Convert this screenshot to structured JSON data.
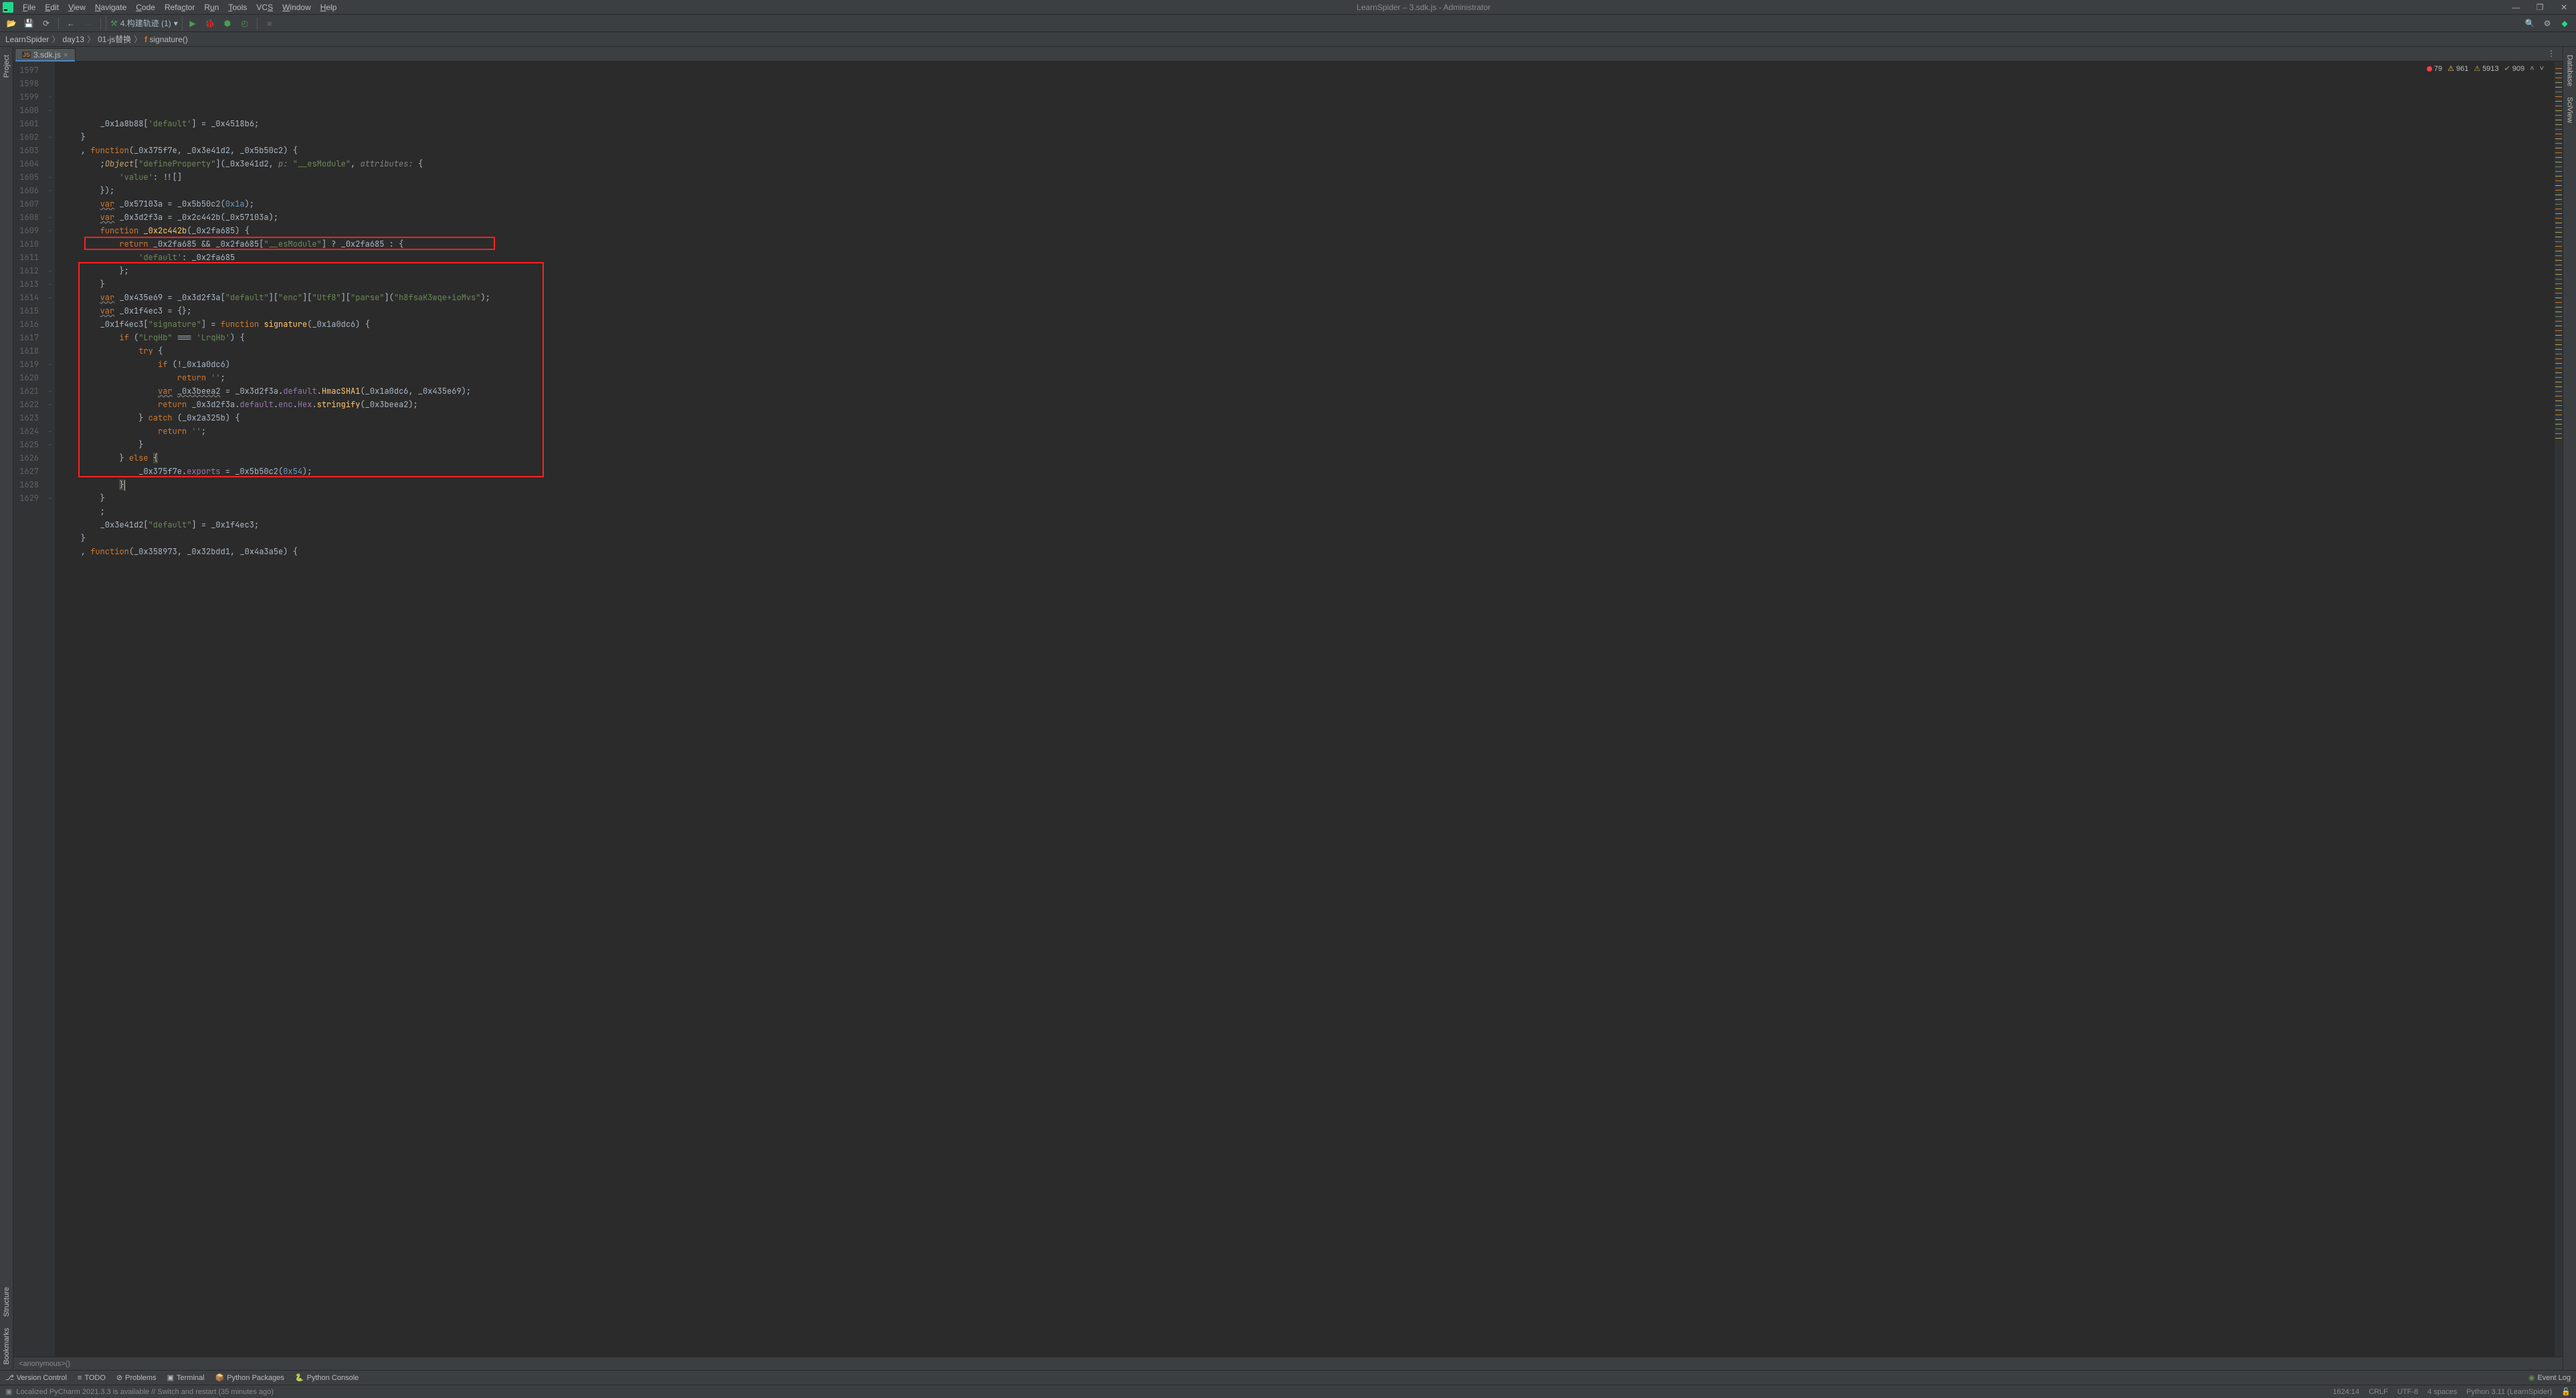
{
  "window": {
    "title": "LearnSpider – 3.sdk.js - Administrator"
  },
  "menus": [
    "File",
    "Edit",
    "View",
    "Navigate",
    "Code",
    "Refactor",
    "Run",
    "Tools",
    "VCS",
    "Window",
    "Help"
  ],
  "menu_underline_idx": [
    0,
    0,
    0,
    0,
    0,
    4,
    1,
    0,
    2,
    0,
    0
  ],
  "run_config": "4.构建轨迹 (1)",
  "breadcrumb": [
    "LearnSpider",
    "day13",
    "01-js替换",
    "signature()"
  ],
  "tabs": [
    {
      "label": "3.sdk.js",
      "active": true
    }
  ],
  "inspection": {
    "errors": "79",
    "warn": "961",
    "weak": "5913",
    "typo": "909"
  },
  "side_left": [
    "Project",
    "Structure",
    "Bookmarks"
  ],
  "side_right": [
    "Database",
    "SciView"
  ],
  "bottom_crumb": "<anonymous>()",
  "bottom_tools": [
    "Version Control",
    "TODO",
    "Problems",
    "Terminal",
    "Python Packages",
    "Python Console"
  ],
  "event_log": "Event Log",
  "status": {
    "msg": "Localized PyCharm 2021.3.3 is available // Switch and restart (35 minutes ago)",
    "pos": "1624:14",
    "sep": "CRLF",
    "enc": "UTF-8",
    "indent": "4 spaces",
    "interp": "Python 3.11 (LearnSpider)"
  },
  "line_start": 1597,
  "code_lines": [
    {
      "n": 1597,
      "html": "        _0x1a8b88[<span class='str'>'default'</span>] = _0x4518b6;",
      "fold": ""
    },
    {
      "n": 1598,
      "html": "    }",
      "fold": ""
    },
    {
      "n": 1599,
      "html": "    , <span class='kw'>function</span>(_0x375f7e, _0x3e41d2, _0x5b50c2) {",
      "fold": "−"
    },
    {
      "n": 1600,
      "html": "        ;<span class='fntype'>Object</span>[<span class='str'>\"defineProperty\"</span>](_0x3e41d2, <span class='param'>p:</span> <span class='str'>\"__esModule\"</span>, <span class='param'>attributes:</span> {",
      "fold": "−"
    },
    {
      "n": 1601,
      "html": "            <span class='str'>'value'</span>: !![]",
      "fold": ""
    },
    {
      "n": 1602,
      "html": "        });",
      "fold": "−"
    },
    {
      "n": 1603,
      "html": "        <span class='kw und'>var</span> _0x57103a = _0x5b50c2(<span class='num'>0x1a</span>);",
      "fold": ""
    },
    {
      "n": 1604,
      "html": "        <span class='kw und'>var</span> _0x3d2f3a = _0x2c442b(_0x57103a);",
      "fold": ""
    },
    {
      "n": 1605,
      "html": "        <span class='kw'>function</span> <span class='fn'>_0x2c442b</span>(_0x2fa685) {",
      "fold": "−"
    },
    {
      "n": 1606,
      "html": "            <span class='kw'>return</span> _0x2fa685 && _0x2fa685[<span class='str'>\"__esModule\"</span>] ? _0x2fa685 : {",
      "fold": "−"
    },
    {
      "n": 1607,
      "html": "                <span class='str'>'default'</span>: _0x2fa685",
      "fold": ""
    },
    {
      "n": 1608,
      "html": "            };",
      "fold": "−"
    },
    {
      "n": 1609,
      "html": "        }",
      "fold": "−"
    },
    {
      "n": 1610,
      "html": "        <span class='kw und'>var</span> _0x435e69 = _0x3d2f3a[<span class='str'>\"default\"</span>][<span class='str'>\"enc\"</span>][<span class='str'>\"Utf8\"</span>][<span class='str'>\"parse\"</span>](<span class='str'>\"h8fsaK3wqe+ioMvs\"</span>);",
      "fold": ""
    },
    {
      "n": 1611,
      "html": "        <span class='kw und'>var</span> _0x1f4ec3 = {};",
      "fold": ""
    },
    {
      "n": 1612,
      "html": "        _0x1f4ec3[<span class='str'>\"signature\"</span>] = <span class='kw'>function</span> <span class='fn'>signature</span>(_0x1a0dc6) {",
      "fold": "−"
    },
    {
      "n": 1613,
      "html": "            <span class='kw'>if</span> (<span class='str'>\"LrqHb\"</span> === <span class='str'>'LrqHb'</span>) {",
      "fold": "−"
    },
    {
      "n": 1614,
      "html": "                <span class='kw'>try</span> {",
      "fold": "−"
    },
    {
      "n": 1615,
      "html": "                    <span class='kw'>if</span> (!_0x1a0dc6)",
      "fold": ""
    },
    {
      "n": 1616,
      "html": "                        <span class='kw'>return</span> <span class='str'>''</span>;",
      "fold": ""
    },
    {
      "n": 1617,
      "html": "                    <span class='kw und'>var</span> <span class='und'>_0x3beea2</span> = _0x3d2f3a.<span class='prop'>default</span>.<span class='fn'>HmacSHA1</span>(_0x1a0dc6, _0x435e69);",
      "fold": ""
    },
    {
      "n": 1618,
      "html": "                    <span class='kw'>return</span> _0x3d2f3a.<span class='prop'>default</span>.<span class='prop'>enc</span>.<span class='prop'>Hex</span>.<span class='fn'>stringify</span>(_0x3beea2);",
      "fold": ""
    },
    {
      "n": 1619,
      "html": "                } <span class='kw'>catch</span> (_0x2a325b) {",
      "fold": "−"
    },
    {
      "n": 1620,
      "html": "                    <span class='kw'>return</span> <span class='str'>''</span>;",
      "fold": ""
    },
    {
      "n": 1621,
      "html": "                }",
      "fold": "−"
    },
    {
      "n": 1622,
      "html": "            } <span class='kw'>else</span> <span style='background:#43443b'>{</span>",
      "fold": "−"
    },
    {
      "n": 1623,
      "html": "                _0x375f7e.<span class='prop'>exports</span> = _0x5b50c2(<span class='num'>0x54</span>);",
      "fold": ""
    },
    {
      "n": 1624,
      "html": "            <span style='background:#43443b'>}</span><span class='caret'></span>",
      "fold": "−",
      "caret": true
    },
    {
      "n": 1625,
      "html": "        }",
      "fold": "−"
    },
    {
      "n": 1626,
      "html": "        ;",
      "fold": ""
    },
    {
      "n": 1627,
      "html": "        _0x3e41d2[<span class='str'>\"default\"</span>] = _0x1f4ec3;",
      "fold": ""
    },
    {
      "n": 1628,
      "html": "    }",
      "fold": ""
    },
    {
      "n": 1629,
      "html": "    , <span class='kw'>function</span>(_0x358973, _0x32bdd1, _0x4a3a5e) {",
      "fold": "−"
    }
  ]
}
